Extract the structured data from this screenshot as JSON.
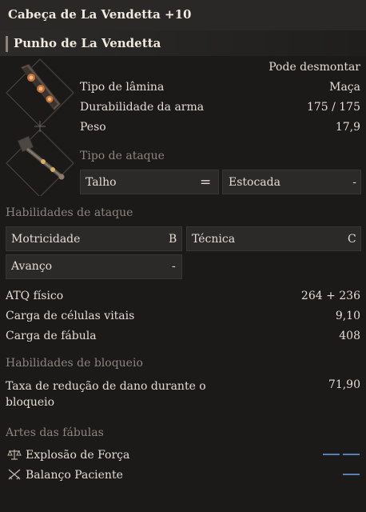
{
  "header": {
    "title": "Cabeça de La Vendetta +10",
    "subtitle": "Punho de La Vendetta"
  },
  "info": {
    "dismantle": "Pode desmontar",
    "blade_type_label": "Tipo de lâmina",
    "blade_type_value": "Maça",
    "durability_label": "Durabilidade da arma",
    "durability_value": "175 / 175",
    "weight_label": "Peso",
    "weight_value": "17,9"
  },
  "attack_type": {
    "header": "Tipo de ataque",
    "left": "Talho",
    "separator": "=",
    "right": "Estocada",
    "right_value": "-"
  },
  "attack_abilities": {
    "header": "Habilidades de ataque",
    "motricity_label": "Motricidade",
    "motricity_value": "B",
    "technique_label": "Técnica",
    "technique_value": "C",
    "advance_label": "Avanço",
    "advance_value": "-"
  },
  "stats": {
    "physical_atk_label": "ATQ físico",
    "physical_atk_value": "264 + 236",
    "vital_cells_label": "Carga de células vitais",
    "vital_cells_value": "9,10",
    "fable_label": "Carga de fábula",
    "fable_value": "408"
  },
  "block": {
    "header": "Habilidades de bloqueio",
    "reduction_label": "Taxa de redução de dano durante o bloqueio",
    "reduction_value": "71,90"
  },
  "fable_arts": {
    "header": "Artes das fábulas",
    "items": [
      {
        "label": "Explosão de Força",
        "icon": "scales-icon",
        "cost_bars": 2
      },
      {
        "label": "Balanço Paciente",
        "icon": "crossed-swords-icon",
        "cost_bars": 1
      }
    ]
  },
  "colors": {
    "background": "#1b1a19",
    "cell": "#2b2a28",
    "accent_blue": "#5a7fb7",
    "muted": "#8a857e"
  }
}
